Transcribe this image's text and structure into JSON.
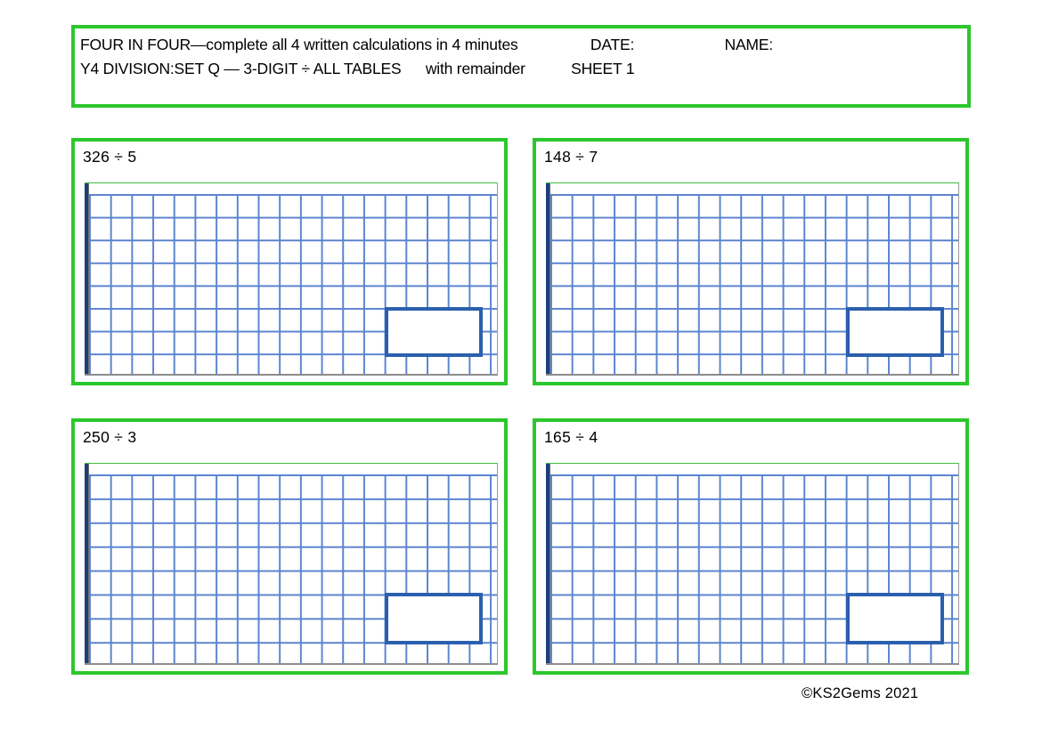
{
  "theme": {
    "border_green": "#2cc72c",
    "grid_blue": "#5b85d0",
    "answer_box_blue": "#2b5fad",
    "rail_navy": "#1c3f78",
    "page_background": "#ffffff",
    "text_color": "#000000"
  },
  "header": {
    "line1": {
      "title": "FOUR IN FOUR—complete all 4 written calculations in 4 minutes",
      "date_label": "DATE:",
      "name_label": "NAME:"
    },
    "line2": {
      "subject": "Y4 DIVISION:SET Q — 3-DIGIT ÷  ALL TABLES",
      "note": "with remainder",
      "sheet_label": "SHEET 1"
    }
  },
  "questions": [
    {
      "id": "q1",
      "label": "326 ÷ 5",
      "dividend": 326,
      "divisor": 5
    },
    {
      "id": "q2",
      "label": "148 ÷ 7",
      "dividend": 148,
      "divisor": 7
    },
    {
      "id": "q3",
      "label": "250 ÷ 3",
      "dividend": 250,
      "divisor": 3
    },
    {
      "id": "q4",
      "label": "165 ÷ 4",
      "dividend": 165,
      "divisor": 4
    }
  ],
  "answer_boxes": [
    {
      "value": ""
    },
    {
      "value": ""
    },
    {
      "value": ""
    },
    {
      "value": ""
    }
  ],
  "footer": {
    "copyright": "©KS2Gems 2021"
  }
}
